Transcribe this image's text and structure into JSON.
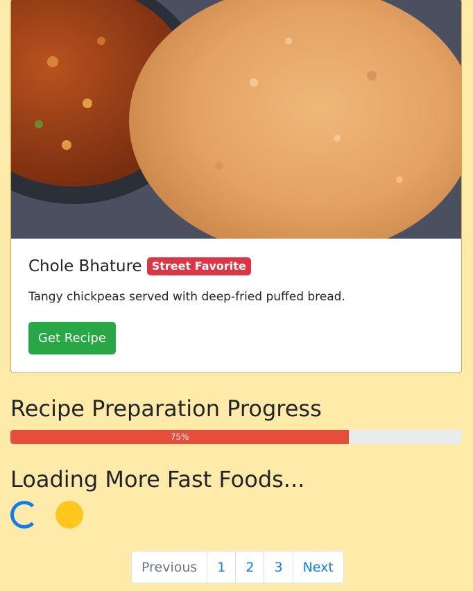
{
  "card": {
    "image_alt": "Chole Bhature",
    "title": "Chole Bhature",
    "badge": "Street Favorite",
    "description": "Tangy chickpeas served with deep-fried puffed bread.",
    "button": "Get Recipe"
  },
  "progress": {
    "heading": "Recipe Preparation Progress",
    "value_percent": 75,
    "label": "75%",
    "color": "#e74c3c"
  },
  "loading": {
    "heading": "Loading More Fast Foods...",
    "spinner_color": "#0d7ef0",
    "grow_color": "#ffc61e"
  },
  "pagination": {
    "previous": "Previous",
    "pages": [
      "1",
      "2",
      "3"
    ],
    "next": "Next"
  },
  "colors": {
    "background": "#ffeba9",
    "badge": "#dc3545",
    "button": "#28a745",
    "link": "#0d7ef0"
  }
}
